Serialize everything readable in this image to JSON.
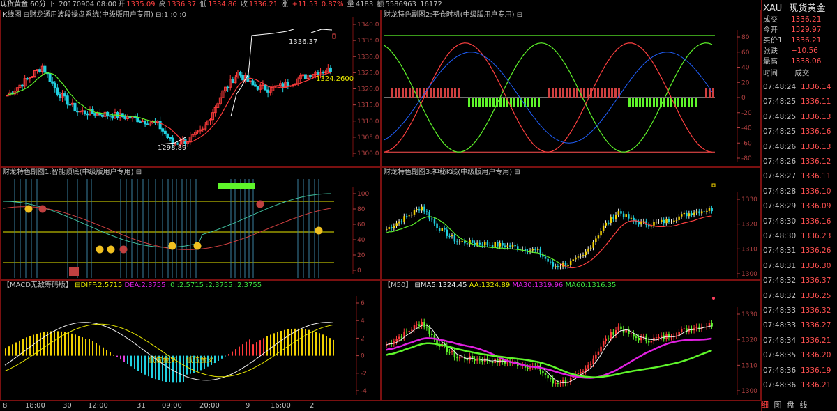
{
  "header": {
    "instrument": "现货黄金 60分 下",
    "datetime": "20170904 08:00",
    "open_label": "开",
    "open": "1335.09",
    "high_label": "高",
    "high": "1336.37",
    "low_label": "低",
    "low": "1334.86",
    "close_label": "收",
    "close": "1336.21",
    "change_label": "涨",
    "change": "+11.53",
    "change_pct": "0.87%",
    "volume_label": "量",
    "volume": "4183",
    "amount_label": "额",
    "amount": "5586963",
    "extra": "16172"
  },
  "panels": {
    "kline": {
      "title": "K线图 ⊟财龙通用波段操盘系统(中级版用户专用) ⊟:1 :0 :0",
      "y_ticks": [
        "1340.0",
        "1335.0",
        "1330.0",
        "1325.0",
        "1320.0",
        "1315.0",
        "1310.0",
        "1305.0",
        "1300.0"
      ],
      "annot_high": "1336.37",
      "annot_low": "1298.89",
      "annot_current": "1324.2600"
    },
    "sub1": {
      "title": "财龙特色副图1:智能顶底(中级版用户专用) ⊟",
      "y_ticks": [
        "100",
        "80",
        "60",
        "40",
        "20",
        "0"
      ]
    },
    "macd": {
      "title_prefix": "【MACD无敌筹码版】",
      "diff_label": "⊟DIFF:2.5715",
      "dea_label": "DEA:2.3755",
      "rest_label": ":0 :2.5715 :2.3755 :2.3755",
      "y_ticks": [
        "6",
        "4",
        "2",
        "0",
        "-2",
        "-4"
      ],
      "annot_1": "低位金叉",
      "annot_2": "低位金叉"
    },
    "sub2": {
      "title": "财龙特色副图2:平仓时机(中级版用户专用) ⊟",
      "y_ticks": [
        "80",
        "60",
        "40",
        "20",
        "0",
        "-20",
        "-40",
        "-60",
        "-80"
      ]
    },
    "sub3": {
      "title": "财龙特色副图3:神秘K线(中级版用户专用) ⊟",
      "y_ticks": [
        "1330",
        "1320",
        "1310",
        "1300"
      ]
    },
    "m50": {
      "title_prefix": "【M50】",
      "ma5": "⊟MA5:1324.45",
      "aa": "AA:1324.89",
      "ma30": "MA30:1319.96",
      "ma60": "MA60:1316.35",
      "y_ticks": [
        "1330",
        "1320",
        "1310",
        "1300"
      ]
    }
  },
  "x_axis": [
    "8",
    "18:00",
    "30",
    "12:00",
    "31",
    "09:00",
    "20:00",
    "9",
    "16:00",
    "2"
  ],
  "quote": {
    "code": "XAU",
    "name": "现货黄金",
    "rows": [
      {
        "label": "成交",
        "value": "1336.21"
      },
      {
        "label": "今开",
        "value": "1329.97"
      },
      {
        "label": "买价1",
        "value": "1336.21"
      },
      {
        "label": "张跌",
        "value": "+10.56"
      },
      {
        "label": "最高",
        "value": "1338.06"
      }
    ],
    "tick_header_time": "时间",
    "tick_header_price": "成交",
    "ticks": [
      {
        "t": "07:48:24",
        "p": "1336.14"
      },
      {
        "t": "07:48:25",
        "p": "1336.11"
      },
      {
        "t": "07:48:25",
        "p": "1336.13"
      },
      {
        "t": "07:48:25",
        "p": "1336.16"
      },
      {
        "t": "07:48:26",
        "p": "1336.13"
      },
      {
        "t": "07:48:26",
        "p": "1336.12"
      },
      {
        "t": "07:48:27",
        "p": "1336.11"
      },
      {
        "t": "07:48:28",
        "p": "1336.10"
      },
      {
        "t": "07:48:29",
        "p": "1336.09"
      },
      {
        "t": "07:48:30",
        "p": "1336.16"
      },
      {
        "t": "07:48:30",
        "p": "1336.23"
      },
      {
        "t": "07:48:31",
        "p": "1336.26"
      },
      {
        "t": "07:48:31",
        "p": "1336.30"
      },
      {
        "t": "07:48:32",
        "p": "1336.37"
      },
      {
        "t": "07:48:32",
        "p": "1336.25"
      },
      {
        "t": "07:48:33",
        "p": "1336.32"
      },
      {
        "t": "07:48:33",
        "p": "1336.27"
      },
      {
        "t": "07:48:34",
        "p": "1336.21"
      },
      {
        "t": "07:48:35",
        "p": "1336.20"
      },
      {
        "t": "07:48:36",
        "p": "1336.19"
      },
      {
        "t": "07:48:36",
        "p": "1336.21"
      }
    ],
    "tabs": [
      "细",
      "图",
      "盘",
      "线"
    ]
  },
  "colors": {
    "up": "#ff3b3b",
    "down": "#20d0e0",
    "grid": "#7a1010",
    "yellow": "#e8e800",
    "green": "#5ef52a",
    "magenta": "#e020e0"
  }
}
